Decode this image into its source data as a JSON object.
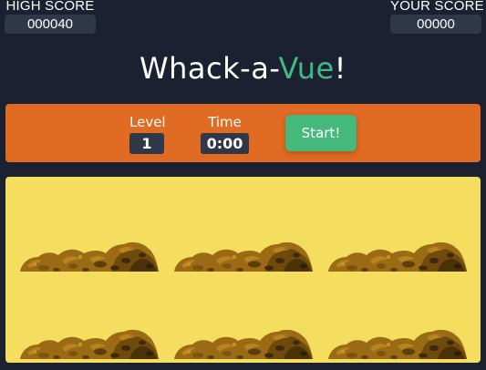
{
  "scores": {
    "high": {
      "label": "HIGH SCORE",
      "value": "000040"
    },
    "yours": {
      "label": "YOUR SCORE",
      "value": "00000"
    }
  },
  "title": {
    "part1": "Whack-a-",
    "accent": "Vue",
    "end": "!"
  },
  "controls": {
    "level_label": "Level",
    "level_value": "1",
    "time_label": "Time",
    "time_value": "0:00",
    "start_label": "Start!"
  },
  "colors": {
    "background": "#1b2130",
    "accent": "#42b883",
    "control_bar": "#e06b22",
    "button": "#45b97c",
    "board": "#f5de5f"
  },
  "board": {
    "holes": [
      "hole-1",
      "hole-2",
      "hole-3",
      "hole-4",
      "hole-5",
      "hole-6"
    ],
    "icon": "dirt-mound-icon"
  }
}
